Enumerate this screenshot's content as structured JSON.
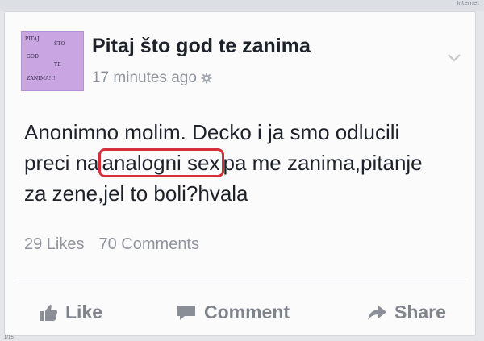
{
  "browser": {
    "corner_label": "Internet",
    "page_label": "1/15"
  },
  "post": {
    "avatar_words": [
      "PITAJ",
      "ŠTO",
      "GOD",
      "TE",
      "ZANIMA!!!"
    ],
    "page_name": "Pitaj što god te zanima",
    "time": "17 minutes ago",
    "privacy_icon": "gear-icon",
    "menu_icon": "chevron-down-icon",
    "text": {
      "line1": "Anonimno molim. Decko i ja smo odlucili",
      "line2_before": "preci na",
      "highlight": "analogni sex",
      "line2_after": "pa me zanima,pitanje",
      "line3": "za zene,jel to boli?hvala"
    },
    "highlight_color": "#d42f3c",
    "likes": "29 Likes",
    "comments": "70 Comments"
  },
  "actions": {
    "like": {
      "label": "Like",
      "icon": "thumbs-up-icon"
    },
    "comment": {
      "label": "Comment",
      "icon": "speech-bubble-icon"
    },
    "share": {
      "label": "Share",
      "icon": "share-arrow-icon"
    }
  }
}
